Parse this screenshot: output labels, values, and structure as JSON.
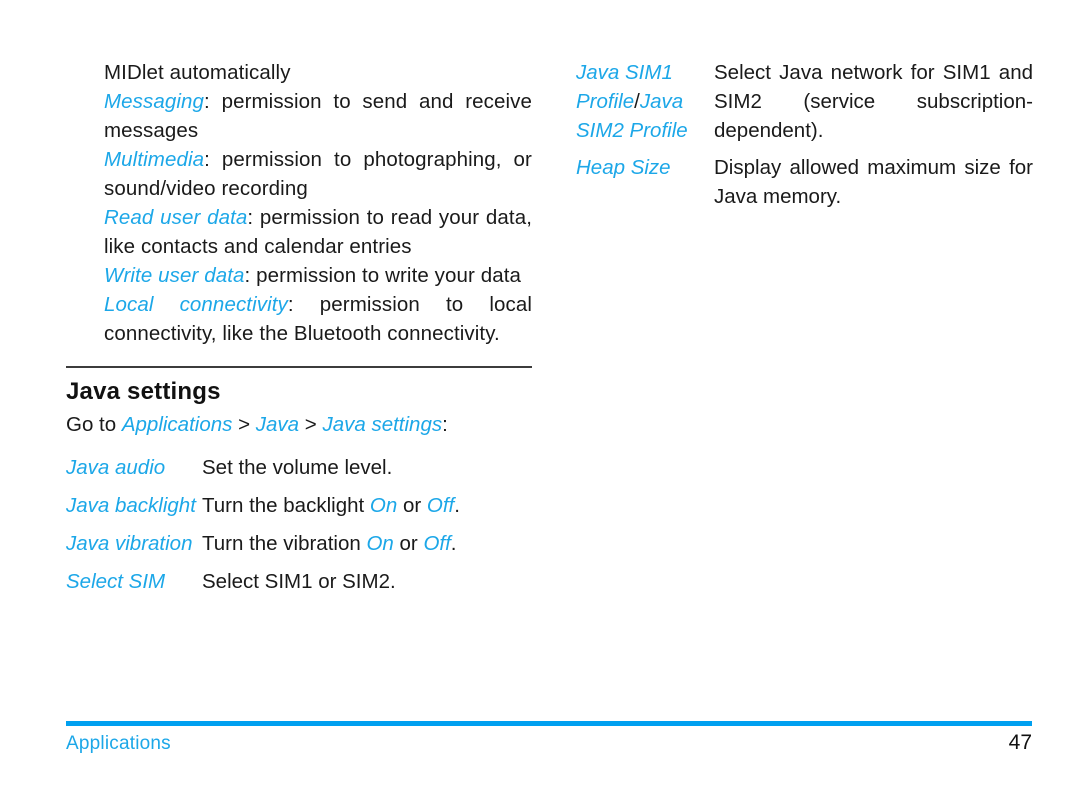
{
  "page": {
    "number": "47",
    "footer_section": "Applications",
    "accent_color": "#1CA7E8",
    "footer_bar_color": "#00A0F0",
    "rule_color": "#3C3C3C"
  },
  "left_column": {
    "continued_paragraphs": [
      {
        "term": "",
        "text": "MIDlet automatically"
      },
      {
        "term": "Messaging",
        "text": ": permission to send and receive messages"
      },
      {
        "term": "Multimedia",
        "text": ": permission to photographing, or sound/video recording"
      },
      {
        "term": "Read user data",
        "text": ": permission to read your data, like contacts and calendar entries"
      },
      {
        "term": "Write user data",
        "text": ": permission to write your data"
      },
      {
        "term": "Local connectivity",
        "text": ": permission to local connectivity, like the Bluetooth connectivity."
      }
    ],
    "section": {
      "title": "Java settings",
      "goto_prefix": "Go to ",
      "goto_path": [
        "Applications",
        "Java",
        "Java settings"
      ],
      "goto_separator": " > ",
      "goto_suffix": ":",
      "rows": [
        {
          "term": "Java audio",
          "desc_before": "Set the volume level.",
          "desc_value_1": "",
          "desc_middle": "",
          "desc_value_2": "",
          "desc_after": ""
        },
        {
          "term": "Java backlight",
          "desc_before": "Turn the backlight ",
          "desc_value_1": "On",
          "desc_middle": " or ",
          "desc_value_2": "Off",
          "desc_after": "."
        },
        {
          "term": "Java vibration",
          "desc_before": "Turn the vibration ",
          "desc_value_1": "On",
          "desc_middle": " or ",
          "desc_value_2": "Off",
          "desc_after": "."
        },
        {
          "term": "Select SIM",
          "desc_before": "Select SIM1 or SIM2.",
          "desc_value_1": "",
          "desc_middle": "",
          "desc_value_2": "",
          "desc_after": ""
        }
      ]
    }
  },
  "right_column": {
    "rows": [
      {
        "term_part_1": "Java SIM1 Profile",
        "term_separator": "/",
        "term_part_2": "Java SIM2 Profile",
        "description": "Select Java network for SIM1 and SIM2 (service subscription-dependent)."
      },
      {
        "term_part_1": "Heap Size",
        "term_separator": "",
        "term_part_2": "",
        "description": "Display allowed maximum size for Java memory."
      }
    ]
  }
}
